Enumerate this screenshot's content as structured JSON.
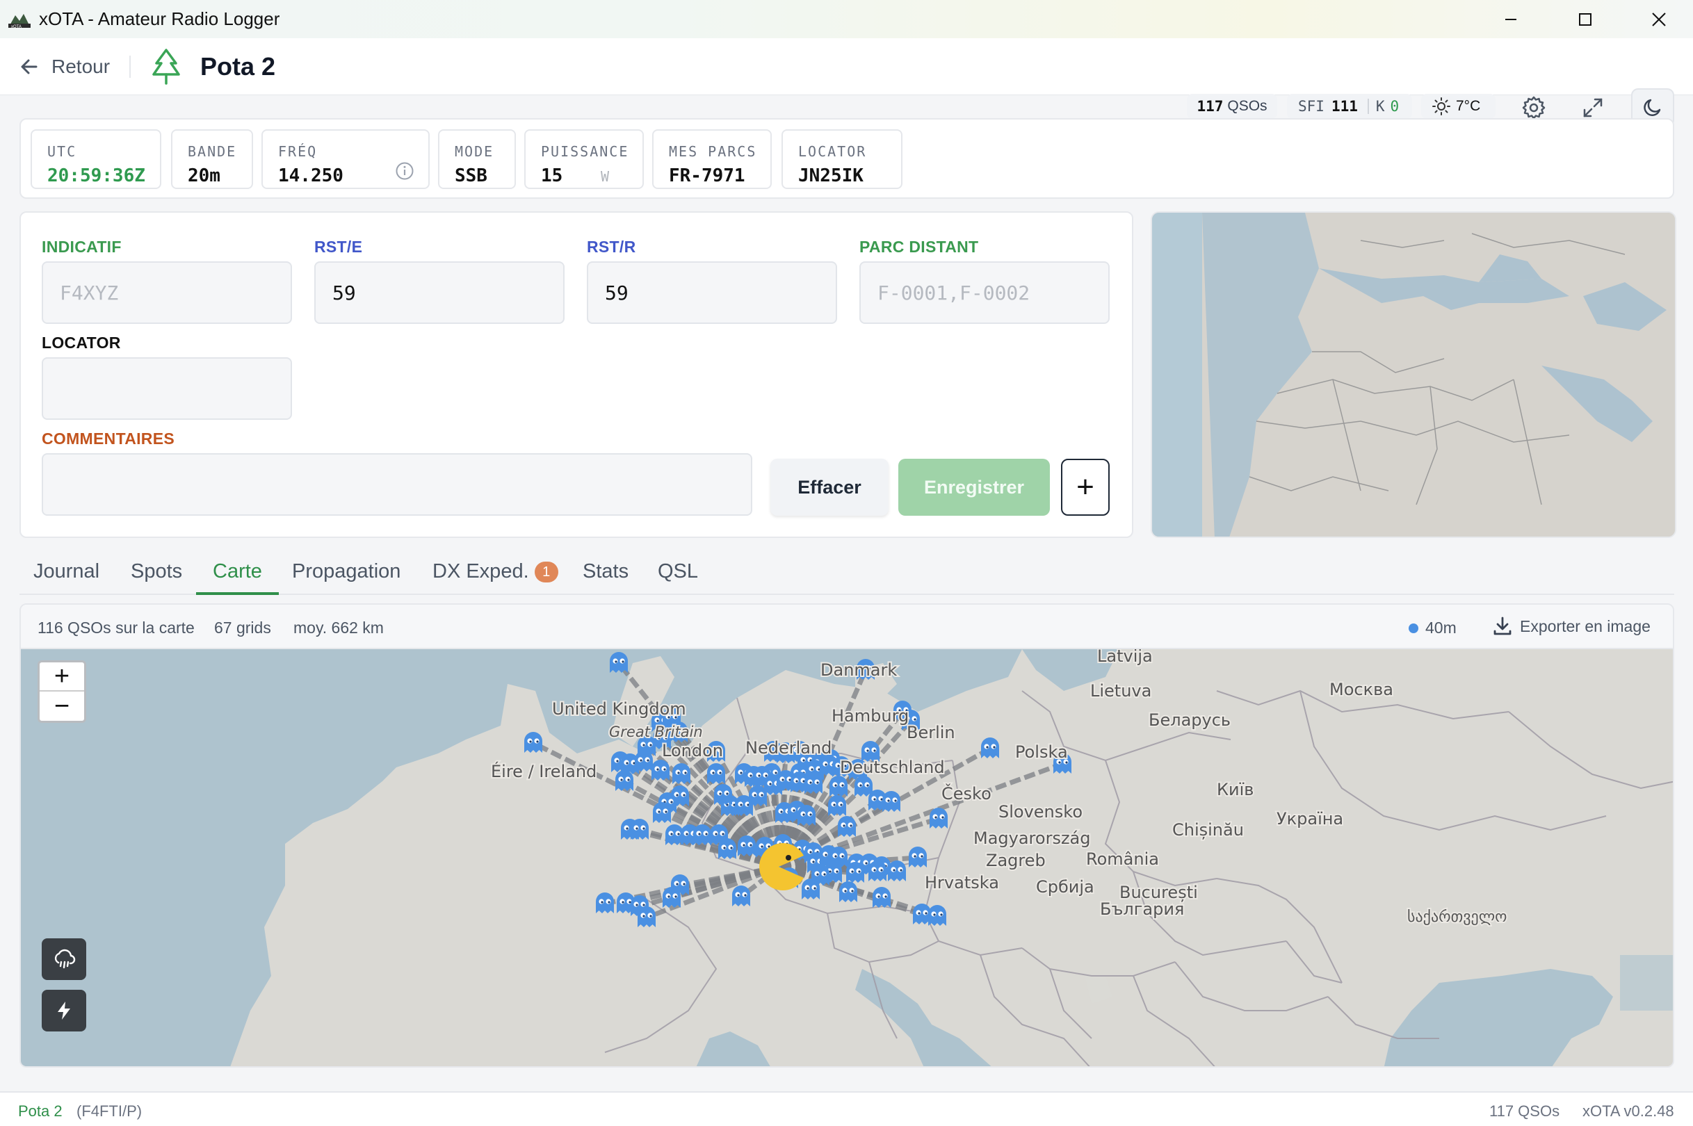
{
  "window": {
    "title": "xOTA - Amateur Radio Logger"
  },
  "header": {
    "back_label": "Retour",
    "page_title": "Pota 2",
    "qso_count": "117",
    "qso_unit": "QSOs",
    "sfi_label": "SFI",
    "sfi_value": "111",
    "k_label": "K",
    "k_value": "0",
    "temperature": "7°C"
  },
  "status": {
    "utc": {
      "label": "UTC",
      "value": "20:59:36Z"
    },
    "band": {
      "label": "BANDE",
      "value": "20m"
    },
    "freq": {
      "label": "FRÉQ",
      "value": "14.250"
    },
    "mode": {
      "label": "MODE",
      "value": "SSB"
    },
    "power": {
      "label": "PUISSANCE",
      "value": "15",
      "unit": "W"
    },
    "parks": {
      "label": "MES PARCS",
      "value": "FR-7971"
    },
    "locator": {
      "label": "LOCATOR",
      "value": "JN25IK"
    }
  },
  "form": {
    "callsign": {
      "label": "INDICATIF",
      "placeholder": "F4XYZ",
      "value": ""
    },
    "rst_sent": {
      "label": "RST/E",
      "value": "59"
    },
    "rst_rcvd": {
      "label": "RST/R",
      "value": "59"
    },
    "remote_park": {
      "label": "PARC DISTANT",
      "placeholder": "F-0001,F-0002",
      "value": ""
    },
    "locator": {
      "label": "LOCATOR",
      "value": ""
    },
    "comments": {
      "label": "COMMENTAIRES",
      "value": ""
    },
    "clear_label": "Effacer",
    "save_label": "Enregistrer",
    "add_label": "+"
  },
  "tabs": [
    {
      "label": "Journal"
    },
    {
      "label": "Spots"
    },
    {
      "label": "Carte",
      "active": true
    },
    {
      "label": "Propagation"
    },
    {
      "label": "DX Exped.",
      "badge": "1"
    },
    {
      "label": "Stats"
    },
    {
      "label": "QSL"
    }
  ],
  "map": {
    "qsos_on_map": "116 QSOs sur la carte",
    "grids": "67 grids",
    "avg_distance": "moy. 662 km",
    "band_filter": "40m",
    "export_label": "Exporter en image",
    "zoom_in": "+",
    "zoom_out": "−",
    "labels": {
      "uk": "United Kingdom",
      "gb": "Great Britain",
      "ie": "Éire / Ireland",
      "lv": "Latvija",
      "lt": "Lietuva",
      "msk": "Москва",
      "by": "Беларусь",
      "dk": "Danmark",
      "hh": "Hamburg",
      "be": "Berlin",
      "nl": "Nederland",
      "de": "Deutschland",
      "pl": "Polska",
      "ldn": "London",
      "kyiv": "Київ",
      "cz": "Česko",
      "ua": "Україна",
      "si": "Slovensko",
      "hu": "Magyarország",
      "md": "Chișinău",
      "zg": "Zagreb",
      "ro": "România",
      "hr": "Hrvatska",
      "rs": "Србија",
      "buc": "București",
      "bg": "България",
      "ge": "საქართველო"
    },
    "ghost_color": "#4a90e2",
    "pacman_color": "#f4c430"
  },
  "footer": {
    "log_name": "Pota 2",
    "callsign": "(F4FTI/P)",
    "qso_count": "117 QSOs",
    "version": "xOTA v0.2.48"
  }
}
